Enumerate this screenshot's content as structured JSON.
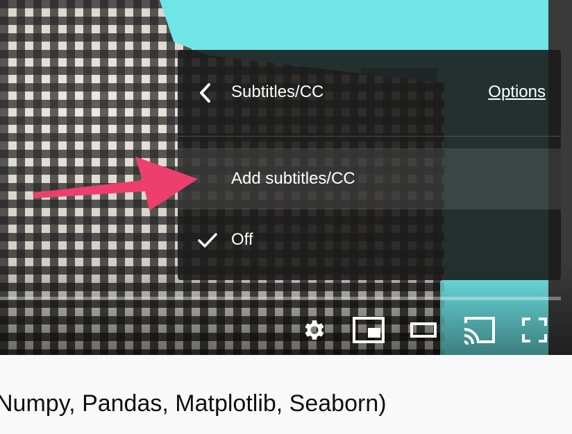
{
  "settings_menu": {
    "title": "Subtitles/CC",
    "options_link": "Options",
    "items": [
      {
        "label": "Add subtitles/CC",
        "highlighted": true,
        "checked": false
      },
      {
        "label": "Off",
        "highlighted": false,
        "checked": true
      }
    ]
  },
  "player_controls": [
    "gear-icon",
    "miniplayer-icon",
    "theater-mode-icon",
    "cast-icon",
    "fullscreen-icon"
  ],
  "annotation": {
    "arrow_color": "#ec3f6e"
  },
  "video_title": "Numpy, Pandas, Matplotlib, Seaborn)"
}
